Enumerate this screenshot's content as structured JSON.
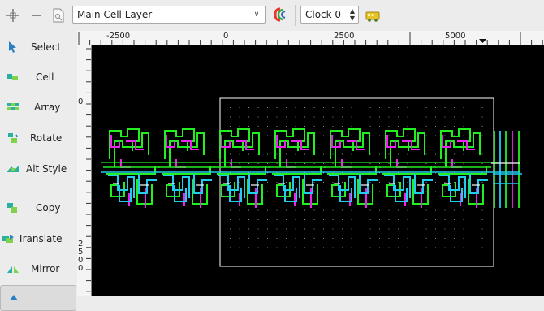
{
  "toolbar": {
    "layer_value": "Main Cell Layer",
    "clock_value": "Clock 0",
    "icons": [
      "crosshair-icon",
      "minus-icon",
      "document-icon",
      "layer-colors-icon",
      "bus-icon"
    ]
  },
  "sidebar": {
    "items": [
      {
        "label": "Select",
        "icon": "select-arrow-icon"
      },
      {
        "label": "Cell",
        "icon": "cell-icon"
      },
      {
        "label": "Array",
        "icon": "array-icon"
      },
      {
        "label": "Rotate",
        "icon": "rotate-icon"
      },
      {
        "label": "Alt Style",
        "icon": "alt-style-icon"
      },
      {
        "label": "Copy",
        "icon": "copy-icon"
      },
      {
        "label": "Translate",
        "icon": "translate-icon"
      },
      {
        "label": "Mirror",
        "icon": "mirror-icon"
      }
    ]
  },
  "ruler": {
    "top_labels": [
      "-2500",
      "0",
      "2500",
      "5000"
    ],
    "left_labels": [
      "0",
      "2",
      "5",
      "0",
      "0"
    ]
  },
  "colors": {
    "green": "#22ee22",
    "magenta": "#ee22ee",
    "cyan": "#22ccee",
    "white": "#ffffff",
    "canvas_bg": "#000000"
  }
}
